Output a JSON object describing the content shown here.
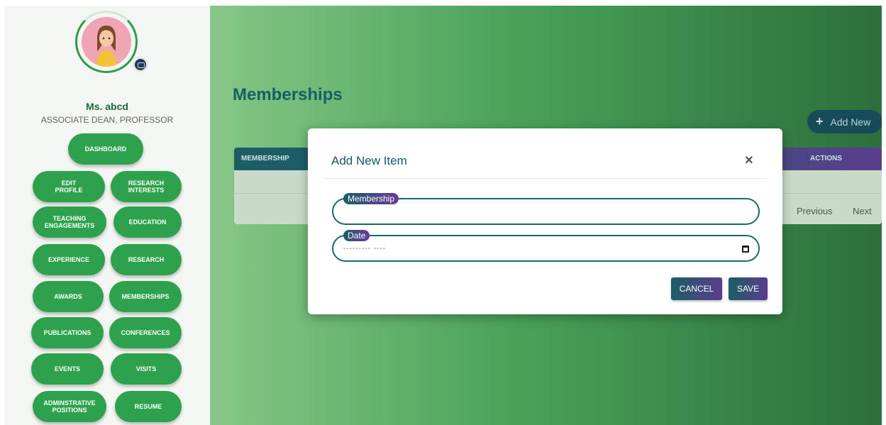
{
  "profile": {
    "name": "Ms. abcd",
    "role": "ASSOCIATE DEAN, PROFESSOR"
  },
  "nav": {
    "dashboard": "DASHBOARD",
    "edit_profile": "EDIT\nPROFILE",
    "research_interests": "RESEARCH\nINTERESTS",
    "teaching_engagements": "TEACHING\nENGAGEMENTS",
    "education": "EDUCATION",
    "experience": "EXPERIENCE",
    "research": "RESEARCH",
    "awards": "AWARDS",
    "memberships": "MEMBERSHIPS",
    "publications": "PUBLICATIONS",
    "conferences": "CONFERENCES",
    "events": "EVENTS",
    "visits": "VISITS",
    "administrative_positions": "ADMINSTRATIVE\nPOSITIONS",
    "resume": "RESUME"
  },
  "main": {
    "title": "Memberships",
    "add_new": "Add New",
    "add_new_icon": "plus-icon",
    "table": {
      "col_membership": "MEMBERSHIP",
      "col_actions": "ACTIONS"
    },
    "pagination": {
      "previous": "Previous",
      "next": "Next"
    }
  },
  "modal": {
    "title": "Add New Item",
    "close_icon": "close-icon",
    "membership_label": "Membership",
    "membership_value": "",
    "date_label": "Date",
    "date_value": "--------- ----",
    "cancel": "CANCEL",
    "save": "SAVE"
  },
  "colors": {
    "nav_green": "#2da14b",
    "brand_teal": "#155f6a",
    "accent_purple": "#5b3d8c"
  }
}
